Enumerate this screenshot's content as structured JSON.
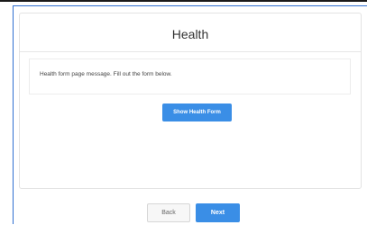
{
  "page": {
    "title": "Health",
    "message": "Health form page message. Fill out the form below.",
    "show_form_label": "Show Health Form"
  },
  "footer": {
    "back_label": "Back",
    "next_label": "Next"
  },
  "colors": {
    "accent": "#3a8ee6",
    "frame_border": "#2f6fd1"
  }
}
